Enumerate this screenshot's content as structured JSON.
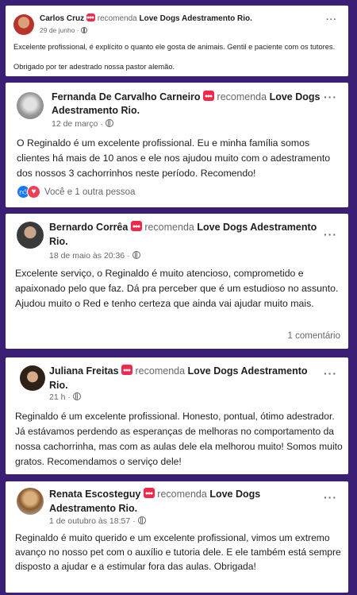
{
  "colors": {
    "background": "#3a1f75",
    "card": "#ffffff",
    "badge": "#f02849",
    "like": "#1877f2",
    "love": "#f33e58"
  },
  "reviews": [
    {
      "name": "Carlos Cruz",
      "verb": "recomenda",
      "page": "Love Dogs Adestramento Rio.",
      "date": "29 de junho ·",
      "text": "Excelente profissional, é explícito o quanto ele gosta de animais. Gentil e paciente com os tutores.",
      "text2": "Obrigado por ter adestrado nossa pastor alemão.",
      "menu": "···"
    },
    {
      "name": "Fernanda De Carvalho Carneiro",
      "verb": "recomenda",
      "page": "Love Dogs Adestramento Rio.",
      "date": "12 de março ·",
      "text": "O Reginaldo é um excelente profissional. Eu e minha família somos clientes há mais de 10 anos e ele nos ajudou muito com o adestramento dos nossos 3 cachorrinhos neste período. Recomendo!",
      "reactions": "Você e 1 outra pessoa",
      "menu": "···"
    },
    {
      "name": "Bernardo Corrêa",
      "verb": "recomenda",
      "page": "Love Dogs Adestramento Rio.",
      "date": "18 de maio às 20:36 ·",
      "text": "Excelente serviço, o Reginaldo é muito atencioso, comprometido e apaixonado pelo que faz. Dá pra perceber que é um estudioso no assunto. Ajudou muito o Red e tenho certeza que ainda vai ajudar muito mais.",
      "comments": "1 comentário",
      "menu": "···"
    },
    {
      "name": "Juliana Freitas",
      "verb": "recomenda",
      "page": "Love Dogs Adestramento Rio.",
      "date": "21 h ·",
      "text": "Reginaldo é um excelente profissional. Honesto, pontual, ótimo adestrador. Já estávamos perdendo as esperanças de melhoras no comportamento da nossa cachorrinha, mas com as aulas dele ela melhorou muito! Somos muito gratos. Recomendamos o serviço dele!",
      "menu": "···"
    },
    {
      "name": "Renata Escosteguy",
      "verb": "recomenda",
      "page": "Love Dogs Adestramento Rio.",
      "date": "1 de outubro às 18:57 ·",
      "text": "Reginaldo é muito querido e um excelente profissional, vimos um extremo avanço no nosso pet com o auxílio e tutoria dele. E ele também está sempre disposto a ajudar e a estimular fora das aulas. Obrigada!",
      "menu": "···"
    }
  ]
}
